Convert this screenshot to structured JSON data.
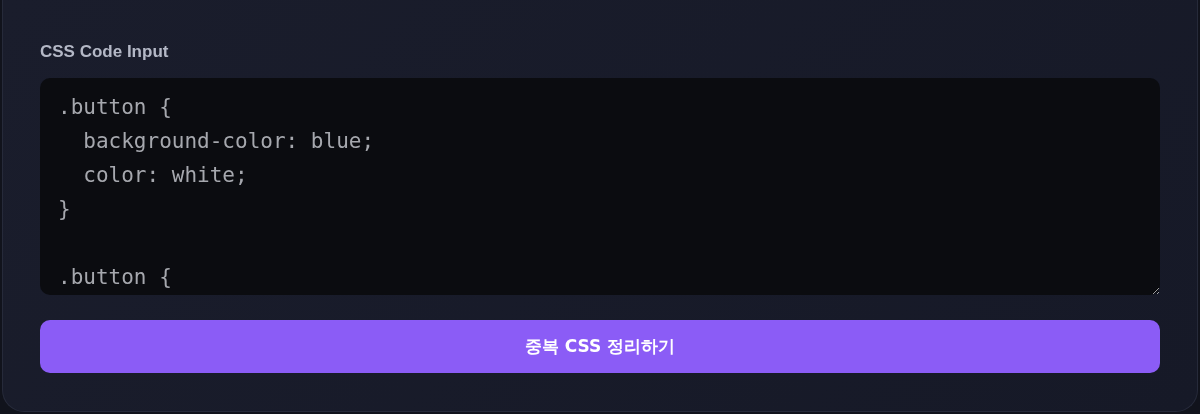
{
  "input_label": "CSS Code Input",
  "code_blocks": [
    [
      ".button {",
      "  background-color: blue;",
      "  color: white;",
      "}"
    ],
    [
      ".button {"
    ]
  ],
  "submit_button": "중복 CSS 정리하기"
}
